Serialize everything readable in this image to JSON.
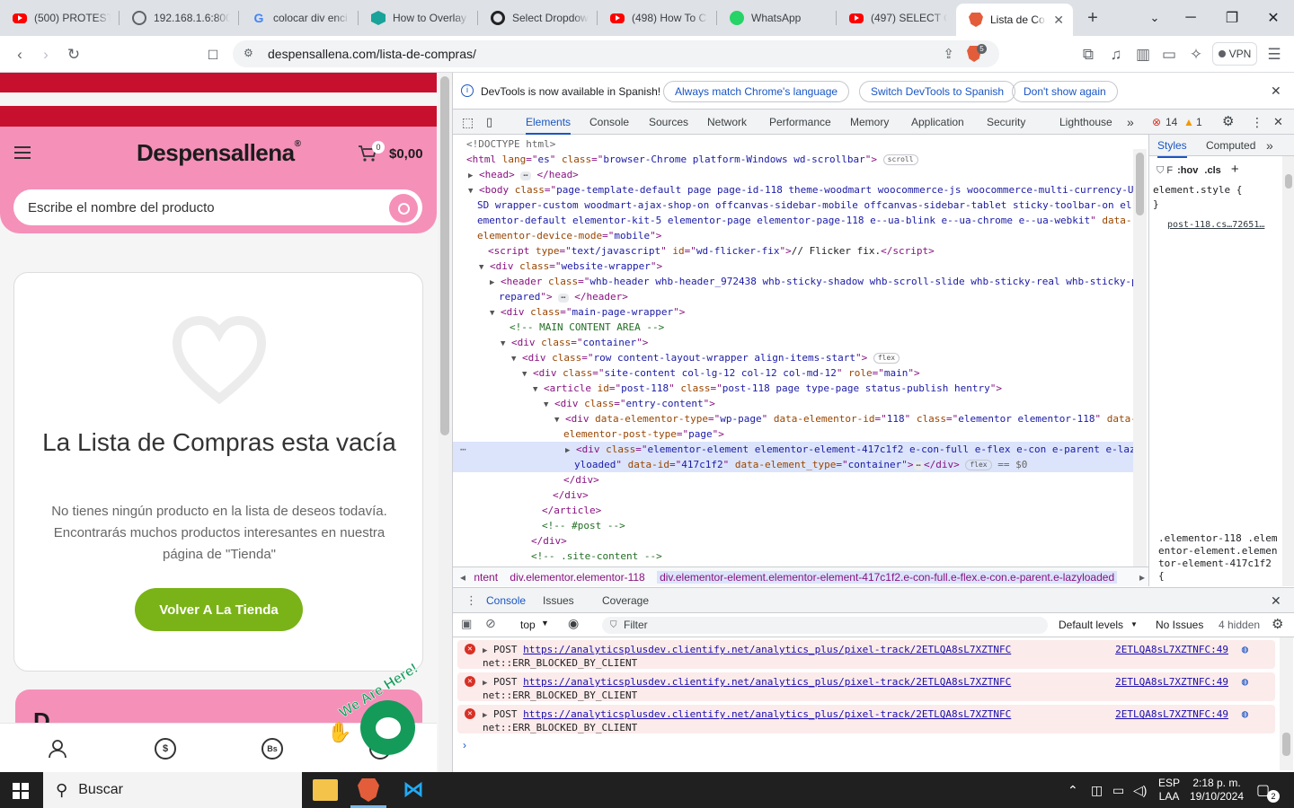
{
  "browser": {
    "tabs": [
      {
        "title": "(500) PROTESTA",
        "favicon": "youtube-icon"
      },
      {
        "title": "192.168.1.6:800",
        "favicon": "globe-icon"
      },
      {
        "title": "colocar div enci",
        "favicon": "google-icon"
      },
      {
        "title": "How to Overlay",
        "favicon": "hex-icon"
      },
      {
        "title": "Select Dropdow",
        "favicon": "selectors-icon"
      },
      {
        "title": "(498) How To C",
        "favicon": "youtube-icon"
      },
      {
        "title": "WhatsApp",
        "favicon": "whatsapp-icon"
      },
      {
        "title": "(497) SELECT O",
        "favicon": "youtube-icon"
      },
      {
        "title": "Lista de Co",
        "favicon": "brave-icon",
        "active": true
      }
    ],
    "url": "despensallena.com/lista-de-compras/",
    "shield_count": "5",
    "vpn_label": "VPN"
  },
  "site": {
    "logo": "Despensallena",
    "cart_count": "0",
    "cart_total": "$0,00",
    "search_placeholder": "Escribe el nombre del producto",
    "empty_title": "La Lista de Compras esta vacía",
    "empty_description": "No tienes ningún producto en la lista de deseos todavía. Encontrarás muchos productos interesantes en nuestra página de \"Tienda\"",
    "back_button": "Volver A La Tienda",
    "chat_badge": "We Are Here!",
    "bottom_nav": [
      "user-icon",
      "dollar-icon",
      "bs-icon"
    ]
  },
  "devtools": {
    "infobar": {
      "message": "DevTools is now available in Spanish!",
      "btn_match": "Always match Chrome's language",
      "btn_switch": "Switch DevTools to Spanish",
      "btn_dismiss": "Don't show again"
    },
    "tabs": [
      "Elements",
      "Console",
      "Sources",
      "Network",
      "Performance",
      "Memory",
      "Application",
      "Security",
      "Lighthouse"
    ],
    "error_count": "14",
    "warning_count": "1",
    "styles_tabs": [
      "Styles",
      "Computed"
    ],
    "styles_filter": "F",
    "styles_hov": ":hov",
    "styles_cls": ".cls",
    "element_style": "element.style {",
    "element_style_close": "}",
    "style_source": "post-118.cs…72651…",
    "style_selector": ".elementor-118 .elementor-element.elementor-element-417c1f2 {",
    "dom": {
      "doctype": "<!DOCTYPE html>",
      "html_lang": "es",
      "html_class": "browser-Chrome platform-Windows wd-scrollbar",
      "badge_scroll": "scroll",
      "body_class": "page-template-default page page-id-118 theme-woodmart woocommerce-js woocommerce-multi-currency-USD wrapper-custom woodmart-ajax-shop-on offcanvas-sidebar-mobile offcanvas-sidebar-tablet sticky-toolbar-on elementor-default elementor-kit-5 elementor-page elementor-page-118 e--ua-blink e--ua-chrome e--ua-webkit",
      "body_class_l1": "page-template-default page page-id-118 theme-woodmart woocommerce-js woocommerce-multi-currency-U",
      "body_class_l2": "SD wrapper-custom woodmart-ajax-shop-on offcanvas-sidebar-mobile offcanvas-sidebar-tablet sticky-toolbar-on el",
      "body_class_l3": "ementor-default elementor-kit-5 elementor-page elementor-page-118 e--ua-blink e--ua-chrome e--ua-webkit",
      "body_mode": "mobile",
      "script_id": "wd-flicker-fix",
      "script_text": "// Flicker fix.",
      "wrapper_class": "website-wrapper",
      "header_class_l1": "whb-header whb-header_972438 whb-sticky-shadow whb-scroll-slide whb-sticky-real whb-sticky-p",
      "header_class_l2": "repared",
      "main_class": "main-page-wrapper",
      "comment_main": "<!-- MAIN CONTENT AREA -->",
      "container_class": "container",
      "row_class": "row content-layout-wrapper align-items-start",
      "badge_flex": "flex",
      "site_class": "site-content col-lg-12 col-12 col-md-12",
      "site_role": "main",
      "article_id": "post-118",
      "article_class": "post-118 page type-page status-publish hentry",
      "entry_class": "entry-content",
      "wp_type": "wp-page",
      "wp_id": "118",
      "wp_class": "elementor elementor-118",
      "wp_post_type": "page",
      "sel_class_l1": "elementor-element elementor-element-417c1f2 e-con-full e-flex e-con e-parent e-laz",
      "sel_class_l2": "yloaded",
      "sel_data_id": "417c1f2",
      "sel_type": "container",
      "sel_eq": "== $0",
      "comment_post": "<!-- #post -->",
      "comment_site": "<!-- .site-content -->"
    },
    "breadcrumbs": [
      "ntent",
      "div.elementor.elementor-118",
      "div.elementor-element.elementor-element-417c1f2.e-con-full.e-flex.e-con.e-parent.e-lazyloaded"
    ],
    "drawer_tabs": [
      "Console",
      "Issues",
      "Coverage"
    ],
    "console": {
      "context": "top",
      "filter_placeholder": "Filter",
      "levels": "Default levels",
      "issues": "No Issues",
      "hidden": "4 hidden",
      "errors": [
        {
          "method": "POST",
          "url": "https://analyticsplusdev.clientify.net/analytics_plus/pixel-track/2ETLQA8sL7XZTNFC",
          "message": "net::ERR_BLOCKED_BY_CLIENT",
          "source": "2ETLQA8sL7XZTNFC:49"
        },
        {
          "method": "POST",
          "url": "https://analyticsplusdev.clientify.net/analytics_plus/pixel-track/2ETLQA8sL7XZTNFC",
          "message": "net::ERR_BLOCKED_BY_CLIENT",
          "source": "2ETLQA8sL7XZTNFC:49"
        },
        {
          "method": "POST",
          "url": "https://analyticsplusdev.clientify.net/analytics_plus/pixel-track/2ETLQA8sL7XZTNFC",
          "message": "net::ERR_BLOCKED_BY_CLIENT",
          "source": "2ETLQA8sL7XZTNFC:49"
        }
      ]
    }
  },
  "taskbar": {
    "search": "Buscar",
    "lang": "ESP",
    "layout": "LAA",
    "time": "2:18 p. m.",
    "date": "19/10/2024",
    "notifications": "2"
  },
  "colors": {
    "pink": "#f590b9",
    "red": "#c7102e",
    "green": "#7ab317",
    "chat": "#149b5a",
    "devtools_blue": "#1a56c4"
  }
}
